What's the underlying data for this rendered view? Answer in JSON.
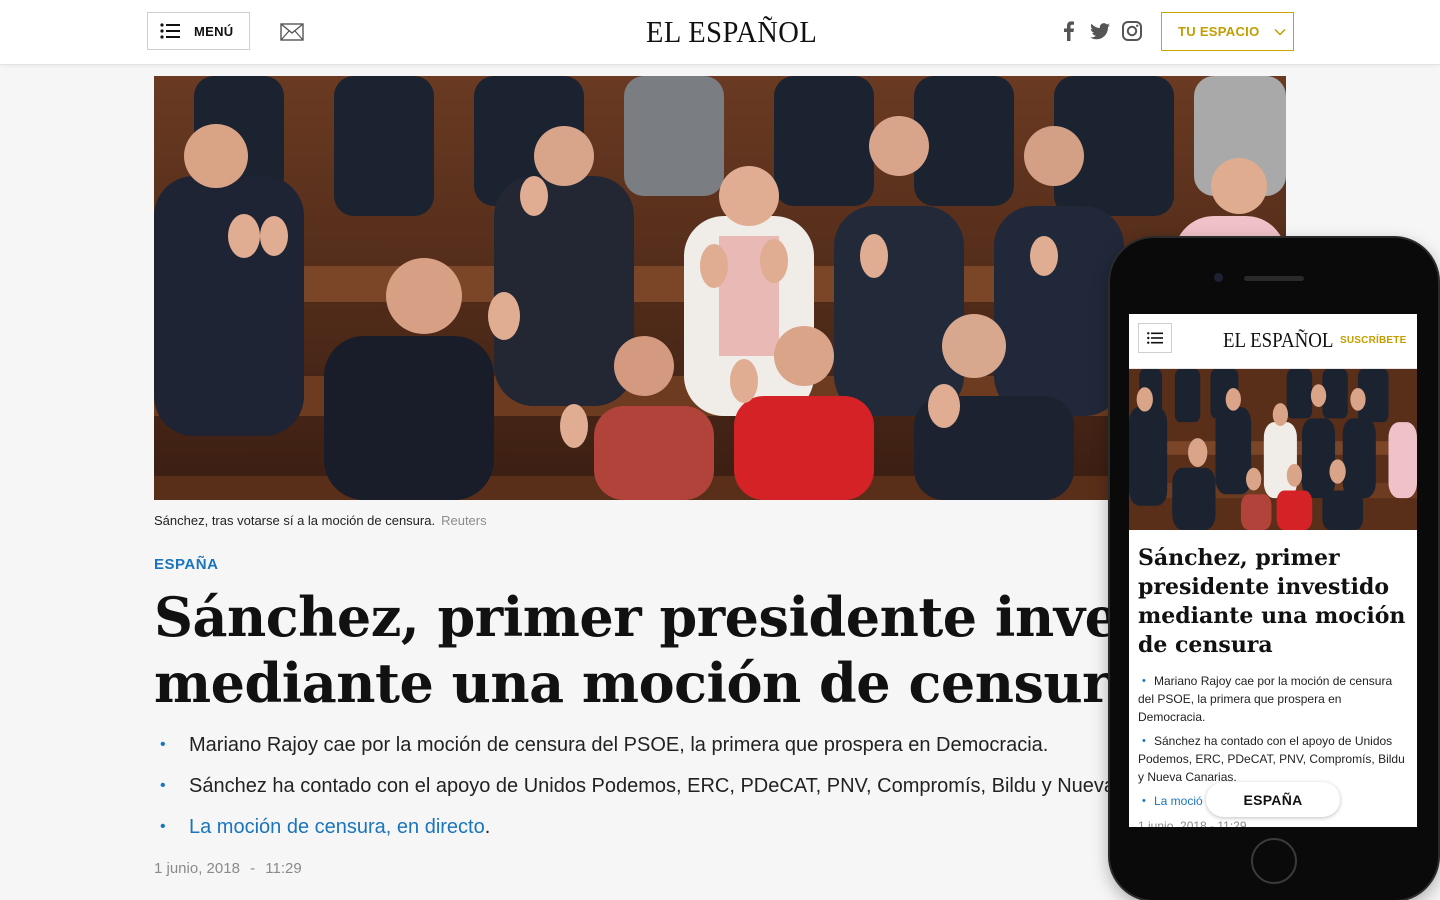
{
  "header": {
    "menu_label": "MENÚ",
    "logo": "EL ESPAÑOL",
    "tu_espacio_label": "TU ESPACIO",
    "icons": [
      "menu-icon",
      "mail-icon",
      "facebook-icon",
      "twitter-icon",
      "instagram-icon",
      "chevron-down-icon"
    ]
  },
  "article": {
    "caption": "Sánchez, tras votarse sí a la moción de censura.",
    "photo_credit": "Reuters",
    "section": "ESPAÑA",
    "headline_line1": "Sánchez, primer presidente investido",
    "headline_line2": "mediante una moción de censura",
    "bullets": [
      "Mariano Rajoy cae por la moción de censura del PSOE, la primera que prospera en Democracia.",
      "Sánchez ha contado con el apoyo de Unidos Podemos, ERC, PDeCAT, PNV, Compromís, Bildu y Nueva Canarias."
    ],
    "live_link": "La moción de censura, en directo",
    "live_link_suffix": ".",
    "date": "1 junio, 2018",
    "time": "11:29",
    "date_separator": "-"
  },
  "mobile": {
    "logo": "EL ESPAÑOL",
    "subscribe_label": "SUSCRÍBETE",
    "headline": "Sánchez, primer presidente investido mediante una moción de censura",
    "bullets": [
      "Mariano Rajoy cae por la moción de censura del PSOE, la primera que prospera en Democracia.",
      "Sánchez ha contado con el apoyo de Unidos Podemos, ERC, PDeCAT, PNV, Compromís, Bildu y Nueva Canarias."
    ],
    "live_link_partial": "La moció",
    "section_pill": "ESPAÑA",
    "date": "1 junio, 2018 - 11:29"
  },
  "colors": {
    "accent_blue": "#1b75bc",
    "gold": "#c39e00",
    "text": "#111111"
  }
}
